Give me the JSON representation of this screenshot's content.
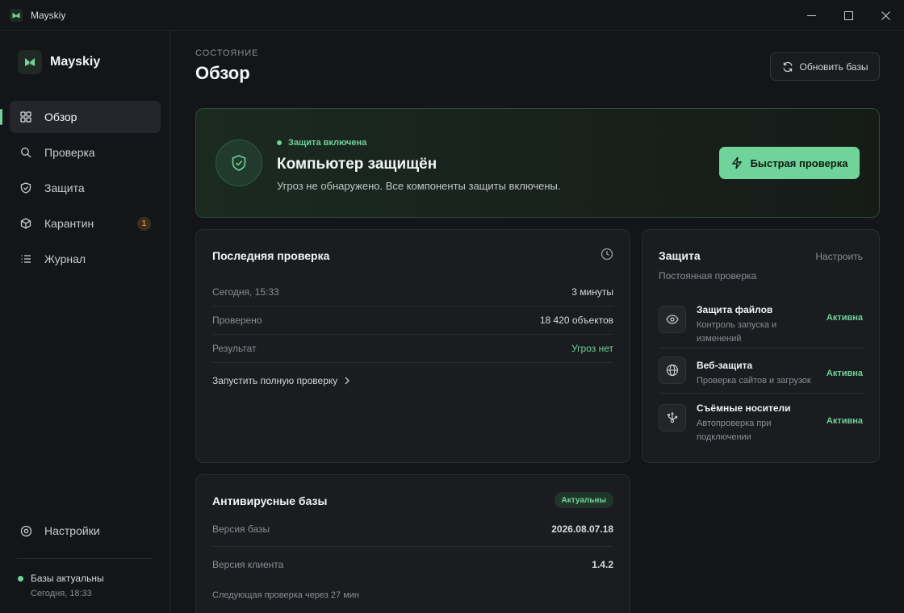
{
  "window": {
    "title": "Mayskiy"
  },
  "sidebar": {
    "brand": "Mayskiy",
    "items": [
      {
        "label": "Обзор",
        "icon": "grid-icon",
        "active": true
      },
      {
        "label": "Проверка",
        "icon": "search-icon"
      },
      {
        "label": "Защита",
        "icon": "shield-icon"
      },
      {
        "label": "Карантин",
        "icon": "box-icon",
        "badge": "1"
      },
      {
        "label": "Журнал",
        "icon": "list-icon"
      }
    ],
    "settings_label": "Настройки",
    "status": {
      "label": "Базы актуальны",
      "time": "Сегодня, 18:33"
    }
  },
  "header": {
    "overline": "СОСТОЯНИЕ",
    "title": "Обзор",
    "refresh_label": "Обновить базы"
  },
  "hero": {
    "status": "Защита включена",
    "title": "Компьютер защищён",
    "subtitle": "Угроз не обнаружено. Все компоненты защиты включены.",
    "quick_scan_label": "Быстрая проверка"
  },
  "last_scan": {
    "title": "Последняя проверка",
    "rows": [
      {
        "key": "Сегодня, 15:33",
        "value": "3 минуты"
      },
      {
        "key": "Проверено",
        "value": "18 420 объектов"
      },
      {
        "key": "Результат",
        "value": "Угроз нет"
      }
    ],
    "full_scan_label": "Запустить полную проверку"
  },
  "protection": {
    "title": "Защита",
    "setup_label": "Настроить",
    "subtitle": "Постоянная проверка",
    "components": [
      {
        "name": "Защита файлов",
        "desc": "Контроль запуска и изменений",
        "state": "Активна",
        "icon": "eye-icon"
      },
      {
        "name": "Веб-защита",
        "desc": "Проверка сайтов и загрузок",
        "state": "Активна",
        "icon": "globe-icon"
      },
      {
        "name": "Съёмные носители",
        "desc": "Автопроверка при подключении",
        "state": "Активна",
        "icon": "usb-icon"
      }
    ]
  },
  "databases": {
    "title": "Антивирусные базы",
    "badge": "Актуальны",
    "rows": [
      {
        "key": "Версия базы",
        "value": "2026.08.07.18"
      },
      {
        "key": "Версия клиента",
        "value": "1.4.2"
      }
    ],
    "next_check": "Следующая проверка через 27 мин"
  },
  "colors": {
    "accent": "#6fd39a",
    "badge_warning": "#e9b25a",
    "background": "#141518",
    "card": "#1b1c20"
  }
}
